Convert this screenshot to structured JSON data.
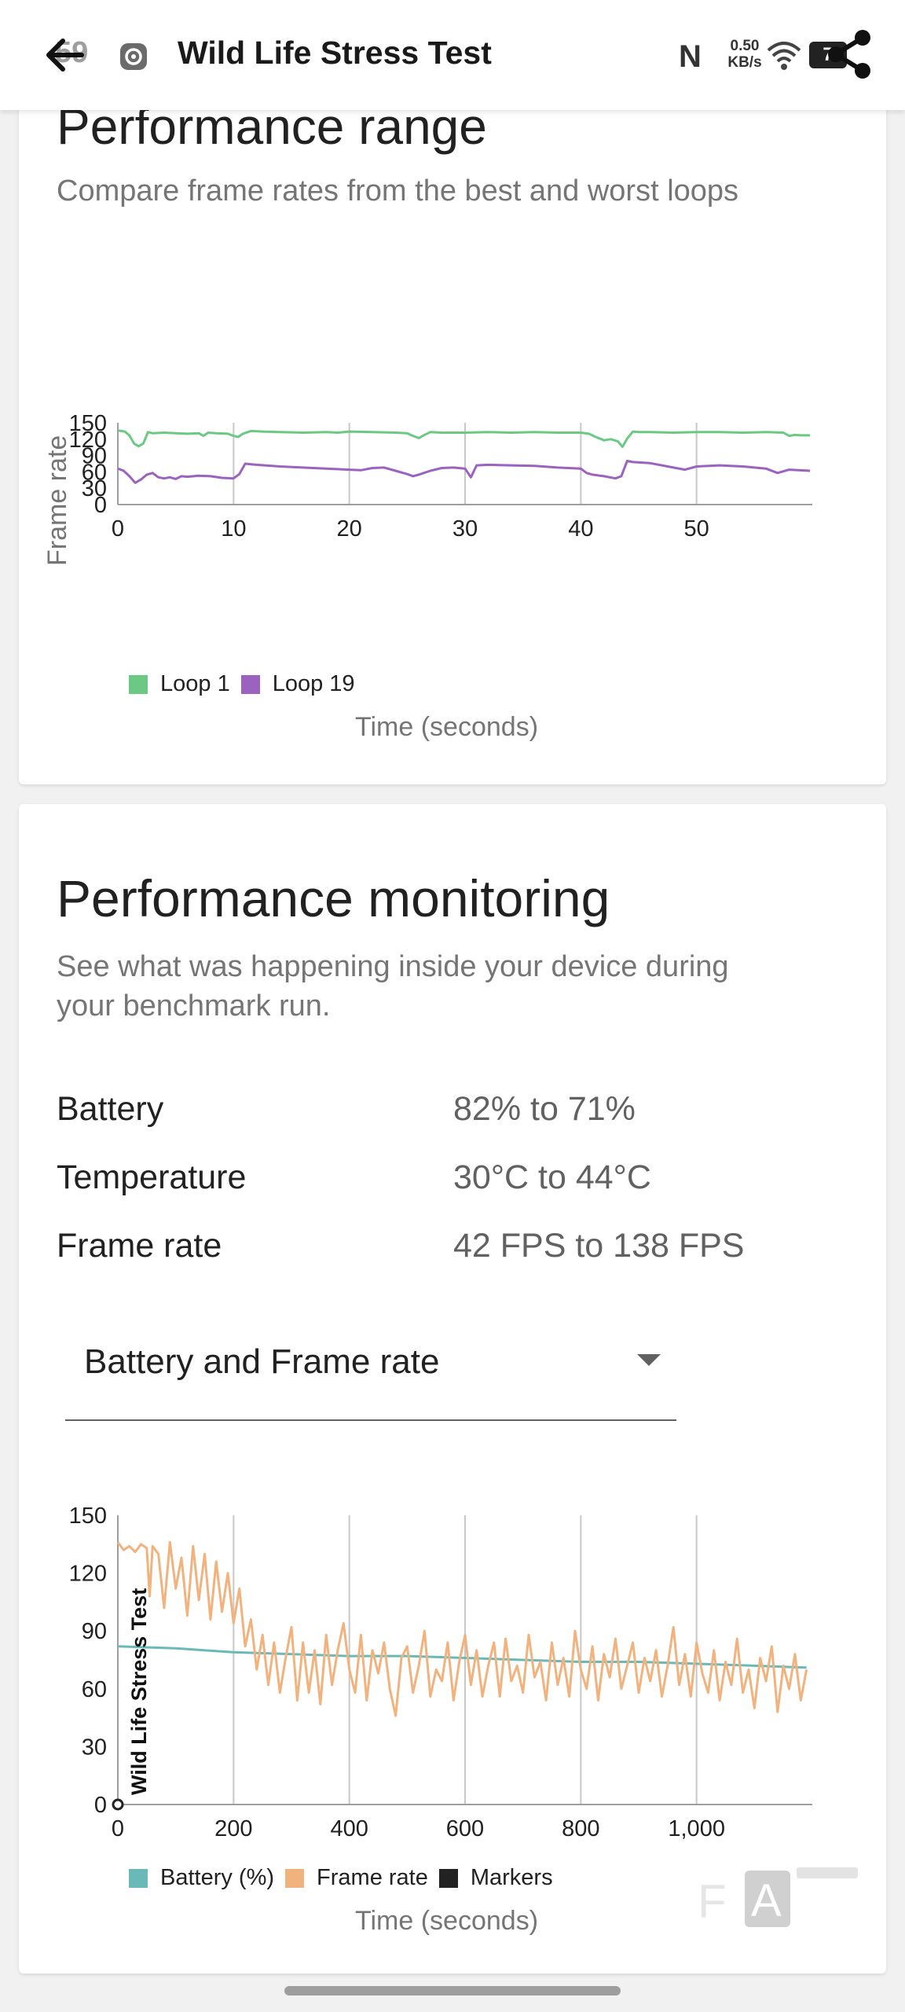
{
  "app_bar": {
    "time": "59",
    "title": "Wild Life Stress Test",
    "network_speed": "0.50",
    "network_unit": "KB/s",
    "battery_level": "7",
    "icons": [
      "back-arrow-icon",
      "settings-gear-icon",
      "nfc-icon",
      "wifi-icon",
      "battery-icon",
      "share-icon"
    ]
  },
  "performance_range": {
    "title": "Performance range",
    "subtitle": "Compare frame rates from the best and worst loops",
    "xlabel": "Time (seconds)",
    "ylabel": "Frame rate",
    "legend": [
      "Loop 1",
      "Loop 19"
    ]
  },
  "performance_monitoring": {
    "title": "Performance monitoring",
    "subtitle_line1": "See what was happening inside your device during",
    "subtitle_line2": "your benchmark run.",
    "stats": [
      {
        "label": "Battery",
        "value": "82% to 71%"
      },
      {
        "label": "Temperature",
        "value": "30°C to 44°C"
      },
      {
        "label": "Frame rate",
        "value": "42 FPS to 138 FPS"
      }
    ],
    "dropdown_value": "Battery and Frame rate",
    "xlabel": "Time (seconds)",
    "marker_label": "Wild Life Stress Test",
    "legend": [
      "Battery (%)",
      "Frame rate",
      "Markers"
    ]
  },
  "colors": {
    "loop1": "#6cc984",
    "loop19": "#9b63bf",
    "battery": "#6ab9b9",
    "frame_rate": "#f2b27e",
    "markers": "#222222"
  },
  "chart_data": [
    {
      "type": "line",
      "title": "Performance range",
      "xlabel": "Time (seconds)",
      "ylabel": "Frame rate",
      "xlim": [
        0,
        60
      ],
      "ylim": [
        0,
        150
      ],
      "x_ticks": [
        "0",
        "10",
        "20",
        "30",
        "40",
        "50"
      ],
      "y_ticks": [
        "0",
        "30",
        "60",
        "90",
        "120",
        "150"
      ],
      "grid": "vertical",
      "legend_position": "bottom-left",
      "series": [
        {
          "name": "Loop 1",
          "x": [
            0,
            0.6,
            1,
            1.4,
            1.8,
            2.2,
            2.6,
            3,
            4,
            5,
            6,
            7,
            7.4,
            7.8,
            8.5,
            9.5,
            10,
            10.4,
            10.8,
            11.5,
            12.5,
            14,
            16,
            18,
            19,
            20,
            22,
            24,
            25,
            25.5,
            26,
            26.5,
            27,
            28,
            30,
            32,
            34,
            36,
            38,
            40,
            40.7,
            41.3,
            42,
            42.6,
            43.2,
            43.6,
            44,
            44.5,
            45,
            46,
            48,
            50,
            52,
            54,
            56,
            57.5,
            58,
            58.5,
            59,
            59.8
          ],
          "y": [
            136,
            134,
            127,
            112,
            107,
            112,
            133,
            131,
            132,
            131,
            130,
            131,
            126,
            132,
            131,
            130,
            126,
            124,
            130,
            135,
            134,
            133,
            132,
            133,
            132,
            134,
            133,
            132,
            131,
            126,
            122,
            128,
            133,
            132,
            132,
            133,
            132,
            133,
            132,
            132,
            130,
            124,
            118,
            120,
            116,
            106,
            121,
            134,
            133,
            133,
            132,
            133,
            133,
            132,
            133,
            132,
            126,
            128,
            127,
            127
          ]
        },
        {
          "name": "Loop 19",
          "x": [
            0,
            0.5,
            1,
            1.5,
            2,
            2.5,
            3,
            3.5,
            4,
            4.5,
            5,
            5.5,
            6,
            7,
            8,
            9,
            10,
            10.5,
            11,
            11.5,
            12,
            14,
            16,
            18,
            20,
            21,
            22,
            23,
            24,
            25,
            25.5,
            26,
            27,
            28,
            29,
            30,
            30.5,
            31,
            32,
            34,
            36,
            38,
            40,
            40.5,
            41,
            42,
            43,
            43.5,
            44,
            44.5,
            46,
            48,
            49,
            50,
            52,
            54,
            56,
            57,
            58,
            59.8
          ],
          "y": [
            66,
            62,
            52,
            40,
            46,
            55,
            58,
            50,
            48,
            50,
            47,
            52,
            51,
            53,
            52,
            49,
            48,
            56,
            75,
            74,
            73,
            70,
            68,
            66,
            64,
            63,
            67,
            68,
            62,
            56,
            52,
            55,
            62,
            67,
            68,
            66,
            50,
            72,
            73,
            72,
            71,
            68,
            66,
            58,
            55,
            52,
            48,
            52,
            80,
            78,
            76,
            68,
            64,
            70,
            72,
            70,
            66,
            58,
            64,
            62
          ]
        }
      ]
    },
    {
      "type": "line",
      "title": "",
      "xlabel": "Time (seconds)",
      "ylabel": "",
      "xlim": [
        0,
        1200
      ],
      "ylim": [
        0,
        150
      ],
      "x_ticks": [
        "0",
        "200",
        "400",
        "600",
        "800",
        "1,000"
      ],
      "y_ticks": [
        "0",
        "30",
        "60",
        "90",
        "120",
        "150"
      ],
      "grid": "vertical",
      "legend_position": "bottom-left",
      "series": [
        {
          "name": "Battery (%)",
          "x": [
            0,
            100,
            200,
            300,
            400,
            500,
            600,
            700,
            800,
            900,
            1000,
            1100,
            1190
          ],
          "y": [
            82,
            81,
            79,
            78,
            77,
            77,
            76,
            75,
            74,
            74,
            73,
            72,
            71
          ]
        },
        {
          "name": "Frame rate",
          "x": [
            0,
            10,
            20,
            30,
            40,
            50,
            55,
            60,
            70,
            80,
            90,
            100,
            110,
            120,
            130,
            140,
            150,
            160,
            170,
            180,
            190,
            200,
            210,
            220,
            230,
            240,
            250,
            260,
            270,
            280,
            290,
            300,
            310,
            320,
            330,
            340,
            350,
            360,
            370,
            380,
            390,
            400,
            410,
            420,
            430,
            440,
            450,
            460,
            470,
            480,
            490,
            500,
            510,
            520,
            530,
            540,
            550,
            560,
            570,
            580,
            590,
            600,
            610,
            620,
            630,
            640,
            650,
            660,
            670,
            680,
            690,
            700,
            710,
            720,
            730,
            740,
            750,
            760,
            770,
            780,
            790,
            800,
            810,
            820,
            830,
            840,
            850,
            860,
            870,
            880,
            890,
            900,
            910,
            920,
            930,
            940,
            950,
            960,
            970,
            980,
            990,
            1000,
            1010,
            1020,
            1030,
            1040,
            1050,
            1060,
            1070,
            1080,
            1090,
            1100,
            1110,
            1120,
            1130,
            1140,
            1150,
            1160,
            1170,
            1180,
            1190
          ],
          "y": [
            136,
            132,
            134,
            131,
            135,
            133,
            108,
            134,
            130,
            102,
            136,
            112,
            128,
            98,
            134,
            106,
            130,
            96,
            126,
            100,
            120,
            94,
            112,
            82,
            96,
            70,
            88,
            62,
            84,
            58,
            76,
            92,
            54,
            84,
            58,
            80,
            52,
            88,
            62,
            80,
            94,
            70,
            58,
            88,
            54,
            80,
            68,
            84,
            60,
            46,
            76,
            82,
            58,
            72,
            90,
            56,
            70,
            64,
            84,
            54,
            74,
            88,
            62,
            80,
            56,
            72,
            84,
            56,
            86,
            64,
            72,
            58,
            88,
            66,
            74,
            54,
            84,
            62,
            76,
            56,
            90,
            70,
            60,
            82,
            54,
            78,
            66,
            86,
            60,
            72,
            84,
            58,
            76,
            64,
            80,
            56,
            72,
            92,
            62,
            78,
            56,
            84,
            68,
            58,
            80,
            54,
            74,
            62,
            86,
            58,
            70,
            50,
            76,
            64,
            82,
            48,
            72,
            60,
            78,
            54,
            70
          ]
        },
        {
          "name": "Markers",
          "x": [
            0
          ],
          "y": [
            0
          ]
        }
      ]
    }
  ]
}
